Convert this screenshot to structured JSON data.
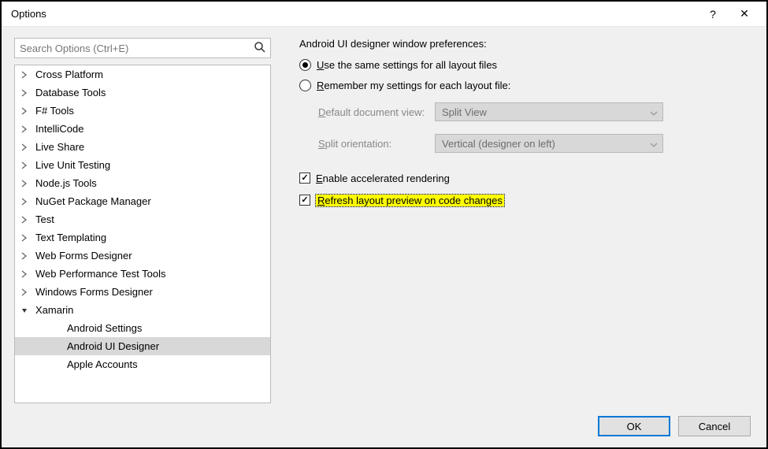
{
  "window": {
    "title": "Options",
    "help_glyph": "?",
    "close_glyph": "✕"
  },
  "search": {
    "placeholder": "Search Options (Ctrl+E)"
  },
  "tree": {
    "items": [
      {
        "label": "Cross Platform",
        "level": 1,
        "expanded": false,
        "selected": false,
        "hasChildren": true
      },
      {
        "label": "Database Tools",
        "level": 1,
        "expanded": false,
        "selected": false,
        "hasChildren": true
      },
      {
        "label": "F# Tools",
        "level": 1,
        "expanded": false,
        "selected": false,
        "hasChildren": true
      },
      {
        "label": "IntelliCode",
        "level": 1,
        "expanded": false,
        "selected": false,
        "hasChildren": true
      },
      {
        "label": "Live Share",
        "level": 1,
        "expanded": false,
        "selected": false,
        "hasChildren": true
      },
      {
        "label": "Live Unit Testing",
        "level": 1,
        "expanded": false,
        "selected": false,
        "hasChildren": true
      },
      {
        "label": "Node.js Tools",
        "level": 1,
        "expanded": false,
        "selected": false,
        "hasChildren": true
      },
      {
        "label": "NuGet Package Manager",
        "level": 1,
        "expanded": false,
        "selected": false,
        "hasChildren": true
      },
      {
        "label": "Test",
        "level": 1,
        "expanded": false,
        "selected": false,
        "hasChildren": true
      },
      {
        "label": "Text Templating",
        "level": 1,
        "expanded": false,
        "selected": false,
        "hasChildren": true
      },
      {
        "label": "Web Forms Designer",
        "level": 1,
        "expanded": false,
        "selected": false,
        "hasChildren": true
      },
      {
        "label": "Web Performance Test Tools",
        "level": 1,
        "expanded": false,
        "selected": false,
        "hasChildren": true
      },
      {
        "label": "Windows Forms Designer",
        "level": 1,
        "expanded": false,
        "selected": false,
        "hasChildren": true
      },
      {
        "label": "Xamarin",
        "level": 1,
        "expanded": true,
        "selected": false,
        "hasChildren": true
      },
      {
        "label": "Android Settings",
        "level": 2,
        "expanded": false,
        "selected": false,
        "hasChildren": false
      },
      {
        "label": "Android UI Designer",
        "level": 2,
        "expanded": false,
        "selected": true,
        "hasChildren": false
      },
      {
        "label": "Apple Accounts",
        "level": 2,
        "expanded": false,
        "selected": false,
        "hasChildren": false
      }
    ]
  },
  "pane": {
    "heading": "Android UI designer window preferences:",
    "radio1": {
      "pre": "U",
      "rest": "se the same settings for all layout files",
      "checked": true
    },
    "radio2": {
      "pre": "R",
      "rest": "emember my settings for each layout file:",
      "checked": false
    },
    "defaultView": {
      "labelPre": "D",
      "labelRest": "efault document view:",
      "value": "Split View"
    },
    "splitOrient": {
      "labelPre": "S",
      "labelRest": "plit orientation:",
      "value": "Vertical (designer on left)"
    },
    "checkAccel": {
      "pre": "E",
      "rest": "nable accelerated rendering",
      "checked": true
    },
    "checkRefresh": {
      "pre": "R",
      "rest": "efresh layout preview on code changes",
      "checked": true,
      "highlighted": true
    }
  },
  "buttons": {
    "ok": "OK",
    "cancel": "Cancel"
  }
}
